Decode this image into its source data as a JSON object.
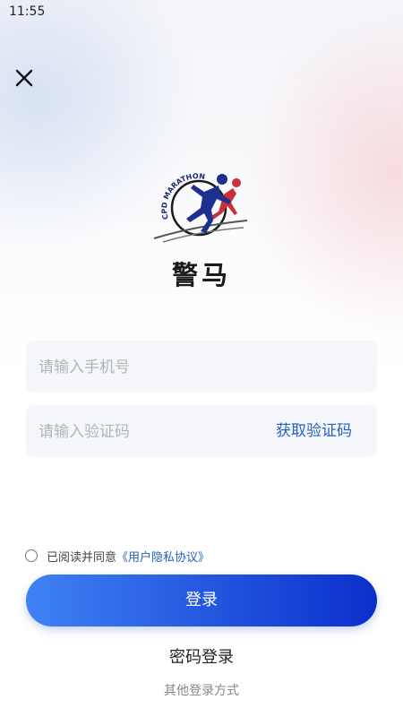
{
  "status_bar": {
    "time": "11:55"
  },
  "header": {
    "close_icon": "close-icon"
  },
  "logo": {
    "ring_text": "CPD MARATHON",
    "brand_name": "警马"
  },
  "form": {
    "phone_placeholder": "请输入手机号",
    "code_placeholder": "请输入验证码",
    "get_code_label": "获取验证码"
  },
  "agreement": {
    "prefix": "已阅读并同意",
    "link": "《用户隐私协议》",
    "checked": false
  },
  "actions": {
    "login_label": "登录",
    "password_login_label": "密码登录",
    "other_login_label": "其他登录方式"
  },
  "colors": {
    "accent": "#2361c4",
    "button_gradient_start": "#3f82f4",
    "button_gradient_end": "#0b2fcc"
  }
}
